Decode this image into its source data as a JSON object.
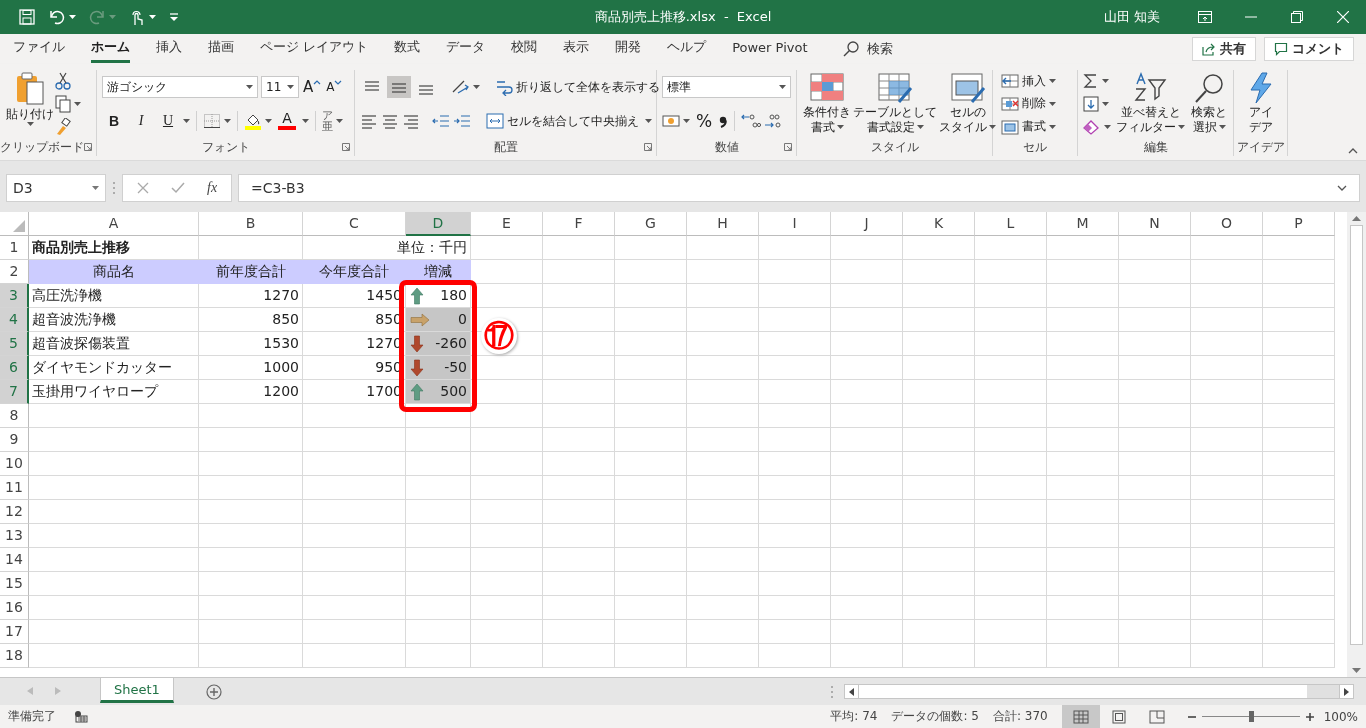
{
  "title_bar": {
    "quick_access": [
      {
        "kind": "save",
        "disabled": false
      },
      {
        "kind": "undo",
        "disabled": false
      },
      {
        "kind": "redo",
        "disabled": true
      },
      {
        "kind": "touch",
        "disabled": false
      },
      {
        "kind": "customize",
        "disabled": false
      }
    ],
    "title": "商品別売上推移.xlsx  -  Excel",
    "user": "山田 知美"
  },
  "ribbon_tabs": [
    {
      "label": "ファイル",
      "selected": false
    },
    {
      "label": "ホーム",
      "selected": true
    },
    {
      "label": "挿入",
      "selected": false
    },
    {
      "label": "描画",
      "selected": false
    },
    {
      "label": "ページ レイアウト",
      "selected": false
    },
    {
      "label": "数式",
      "selected": false
    },
    {
      "label": "データ",
      "selected": false
    },
    {
      "label": "校閲",
      "selected": false
    },
    {
      "label": "表示",
      "selected": false
    },
    {
      "label": "開発",
      "selected": false
    },
    {
      "label": "ヘルプ",
      "selected": false
    },
    {
      "label": "Power Pivot",
      "selected": false
    }
  ],
  "search": {
    "label": "検索"
  },
  "share_button": "共有",
  "comment_button": "コメント",
  "ribbon": {
    "clipboard": {
      "paste": "貼り付け",
      "label": "クリップボード"
    },
    "font": {
      "name": "游ゴシック",
      "size": "11",
      "size_buttons": [
        {
          "kind": "grow",
          "label": "A"
        },
        {
          "kind": "shrink",
          "label": "A"
        }
      ],
      "style_buttons": [
        {
          "kind": "bold",
          "label": "B"
        },
        {
          "kind": "italic",
          "label": "I"
        },
        {
          "kind": "underline",
          "label": "U"
        }
      ],
      "font_color": "A",
      "phonetic": "ア亜",
      "label": "フォント"
    },
    "alignment": {
      "vertical_align": [
        {
          "kind": "top",
          "selected": false
        },
        {
          "kind": "middle",
          "selected": true
        },
        {
          "kind": "bottom",
          "selected": false
        }
      ],
      "wrap_text": "折り返して全体を表示する",
      "merge": "セルを結合して中央揃え",
      "label": "配置"
    },
    "number": {
      "format": "標準",
      "percent": "%",
      "label": "数値"
    },
    "styles": {
      "buttons": [
        {
          "kind": "conditional",
          "lines": [
            "条件付き",
            "書式"
          ]
        },
        {
          "kind": "table",
          "lines": [
            "テーブルとして",
            "書式設定"
          ]
        },
        {
          "kind": "cell",
          "lines": [
            "セルの",
            "スタイル"
          ]
        }
      ],
      "label": "スタイル"
    },
    "cells": {
      "buttons": [
        {
          "kind": "insert",
          "label": "挿入"
        },
        {
          "kind": "delete",
          "label": "削除"
        },
        {
          "kind": "format",
          "label": "書式"
        }
      ],
      "label": "セル"
    },
    "editing": {
      "buttons": [
        {
          "kind": "sort",
          "lines": [
            "並べ替えと",
            "フィルター"
          ]
        },
        {
          "kind": "find",
          "lines": [
            "検索と",
            "選択"
          ]
        }
      ],
      "label": "編集"
    },
    "ideas": {
      "lines": [
        "アイ",
        "デア"
      ],
      "label": "アイデア"
    }
  },
  "formula_bar": {
    "name_box": "D3",
    "function_label": "fx",
    "formula": "=C3-B3"
  },
  "sheet": {
    "columns": [
      {
        "label": "A",
        "selected": false
      },
      {
        "label": "B",
        "selected": false
      },
      {
        "label": "C",
        "selected": false
      },
      {
        "label": "D",
        "selected": true
      },
      {
        "label": "E",
        "selected": false
      },
      {
        "label": "F",
        "selected": false
      },
      {
        "label": "G",
        "selected": false
      },
      {
        "label": "H",
        "selected": false
      },
      {
        "label": "I",
        "selected": false
      },
      {
        "label": "J",
        "selected": false
      },
      {
        "label": "K",
        "selected": false
      },
      {
        "label": "L",
        "selected": false
      },
      {
        "label": "M",
        "selected": false
      },
      {
        "label": "N",
        "selected": false
      },
      {
        "label": "O",
        "selected": false
      },
      {
        "label": "P",
        "selected": false
      }
    ],
    "rows": [
      {
        "label": "1",
        "kind": "title",
        "selected": false,
        "title": "商品別売上推移",
        "unit": "単位：千円"
      },
      {
        "label": "2",
        "kind": "header",
        "selected": false,
        "cells": [
          "商品名",
          "前年度合計",
          "今年度合計",
          "増減"
        ]
      },
      {
        "label": "3",
        "kind": "data",
        "selected": true,
        "active": true,
        "name": "高圧洗浄機",
        "previous": "1270",
        "current": "1450",
        "change": "180",
        "icon": {
          "kind": "up"
        }
      },
      {
        "label": "4",
        "kind": "data",
        "selected": true,
        "active": false,
        "name": "超音波洗浄機",
        "previous": "850",
        "current": "850",
        "change": "0",
        "icon": {
          "kind": "flat"
        }
      },
      {
        "label": "5",
        "kind": "data",
        "selected": true,
        "active": false,
        "name": "超音波探傷装置",
        "previous": "1530",
        "current": "1270",
        "change": "-260",
        "icon": {
          "kind": "down"
        }
      },
      {
        "label": "6",
        "kind": "data",
        "selected": true,
        "active": false,
        "name": "ダイヤモンドカッター",
        "previous": "1000",
        "current": "950",
        "change": "-50",
        "icon": {
          "kind": "down"
        }
      },
      {
        "label": "7",
        "kind": "data",
        "selected": true,
        "active": false,
        "name": "玉掛用ワイヤロープ",
        "previous": "1200",
        "current": "1700",
        "change": "500",
        "icon": {
          "kind": "up"
        }
      },
      {
        "label": "8",
        "kind": "empty",
        "selected": false
      },
      {
        "label": "9",
        "kind": "empty",
        "selected": false
      },
      {
        "label": "10",
        "kind": "empty",
        "selected": false
      },
      {
        "label": "11",
        "kind": "empty",
        "selected": false
      },
      {
        "label": "12",
        "kind": "empty",
        "selected": false
      },
      {
        "label": "13",
        "kind": "empty",
        "selected": false
      },
      {
        "label": "14",
        "kind": "empty",
        "selected": false
      },
      {
        "label": "15",
        "kind": "empty",
        "selected": false
      },
      {
        "label": "16",
        "kind": "empty",
        "selected": false
      },
      {
        "label": "17",
        "kind": "empty",
        "selected": false
      },
      {
        "label": "18",
        "kind": "empty",
        "selected": false
      }
    ],
    "annotation": "⑰"
  },
  "sheet_tabs": [
    {
      "label": "Sheet1",
      "selected": true
    }
  ],
  "status_bar": {
    "status": "準備完了",
    "stats": [
      "平均: 74",
      "データの個数: 5",
      "合計: 370"
    ],
    "views": [
      {
        "kind": "normal",
        "selected": true
      },
      {
        "kind": "page_layout",
        "selected": false
      },
      {
        "kind": "page_break",
        "selected": false
      }
    ],
    "zoom_slider": {
      "level": 0.5
    },
    "zoom": "100%"
  }
}
